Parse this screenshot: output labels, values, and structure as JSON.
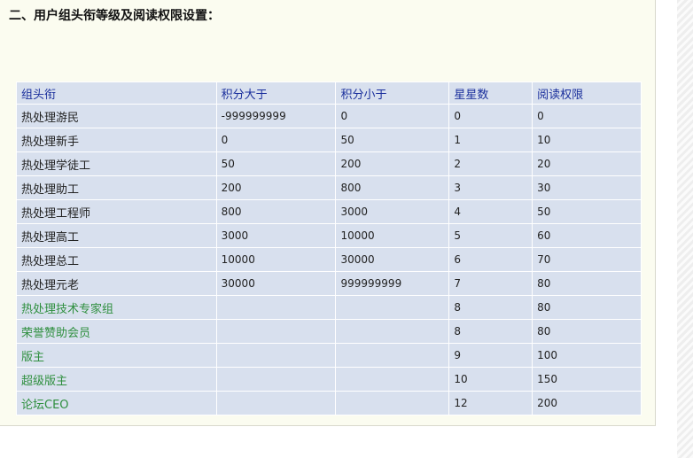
{
  "heading": "二、用户组头衔等级及阅读权限设置：",
  "table": {
    "headers": [
      "组头衔",
      "积分大于",
      "积分小于",
      "星星数",
      "阅读权限"
    ],
    "rows": [
      {
        "title": "热处理游民",
        "min": "-999999999",
        "max": "0",
        "stars": "0",
        "read": "0",
        "special": false
      },
      {
        "title": "热处理新手",
        "min": "0",
        "max": "50",
        "stars": "1",
        "read": "10",
        "special": false
      },
      {
        "title": "热处理学徒工",
        "min": "50",
        "max": "200",
        "stars": "2",
        "read": "20",
        "special": false
      },
      {
        "title": "热处理助工",
        "min": "200",
        "max": "800",
        "stars": "3",
        "read": "30",
        "special": false
      },
      {
        "title": "热处理工程师",
        "min": "800",
        "max": "3000",
        "stars": "4",
        "read": "50",
        "special": false
      },
      {
        "title": "热处理高工",
        "min": "3000",
        "max": "10000",
        "stars": "5",
        "read": "60",
        "special": false
      },
      {
        "title": "热处理总工",
        "min": "10000",
        "max": "30000",
        "stars": "6",
        "read": "70",
        "special": false
      },
      {
        "title": "热处理元老",
        "min": "30000",
        "max": "999999999",
        "stars": "7",
        "read": "80",
        "special": false
      },
      {
        "title": "热处理技术专家组",
        "min": "",
        "max": "",
        "stars": "8",
        "read": "80",
        "special": true
      },
      {
        "title": "荣誉赞助会员",
        "min": "",
        "max": "",
        "stars": "8",
        "read": "80",
        "special": true
      },
      {
        "title": "版主",
        "min": "",
        "max": "",
        "stars": "9",
        "read": "100",
        "special": true
      },
      {
        "title": "超级版主",
        "min": "",
        "max": "",
        "stars": "10",
        "read": "150",
        "special": true
      },
      {
        "title": "论坛CEO",
        "min": "",
        "max": "",
        "stars": "12",
        "read": "200",
        "special": true
      }
    ]
  },
  "colors": {
    "header_text": "#1a2f9c",
    "special_text": "#2f8f3f",
    "table_bg": "#d8e0ee",
    "panel_bg": "#fbfcf0"
  }
}
